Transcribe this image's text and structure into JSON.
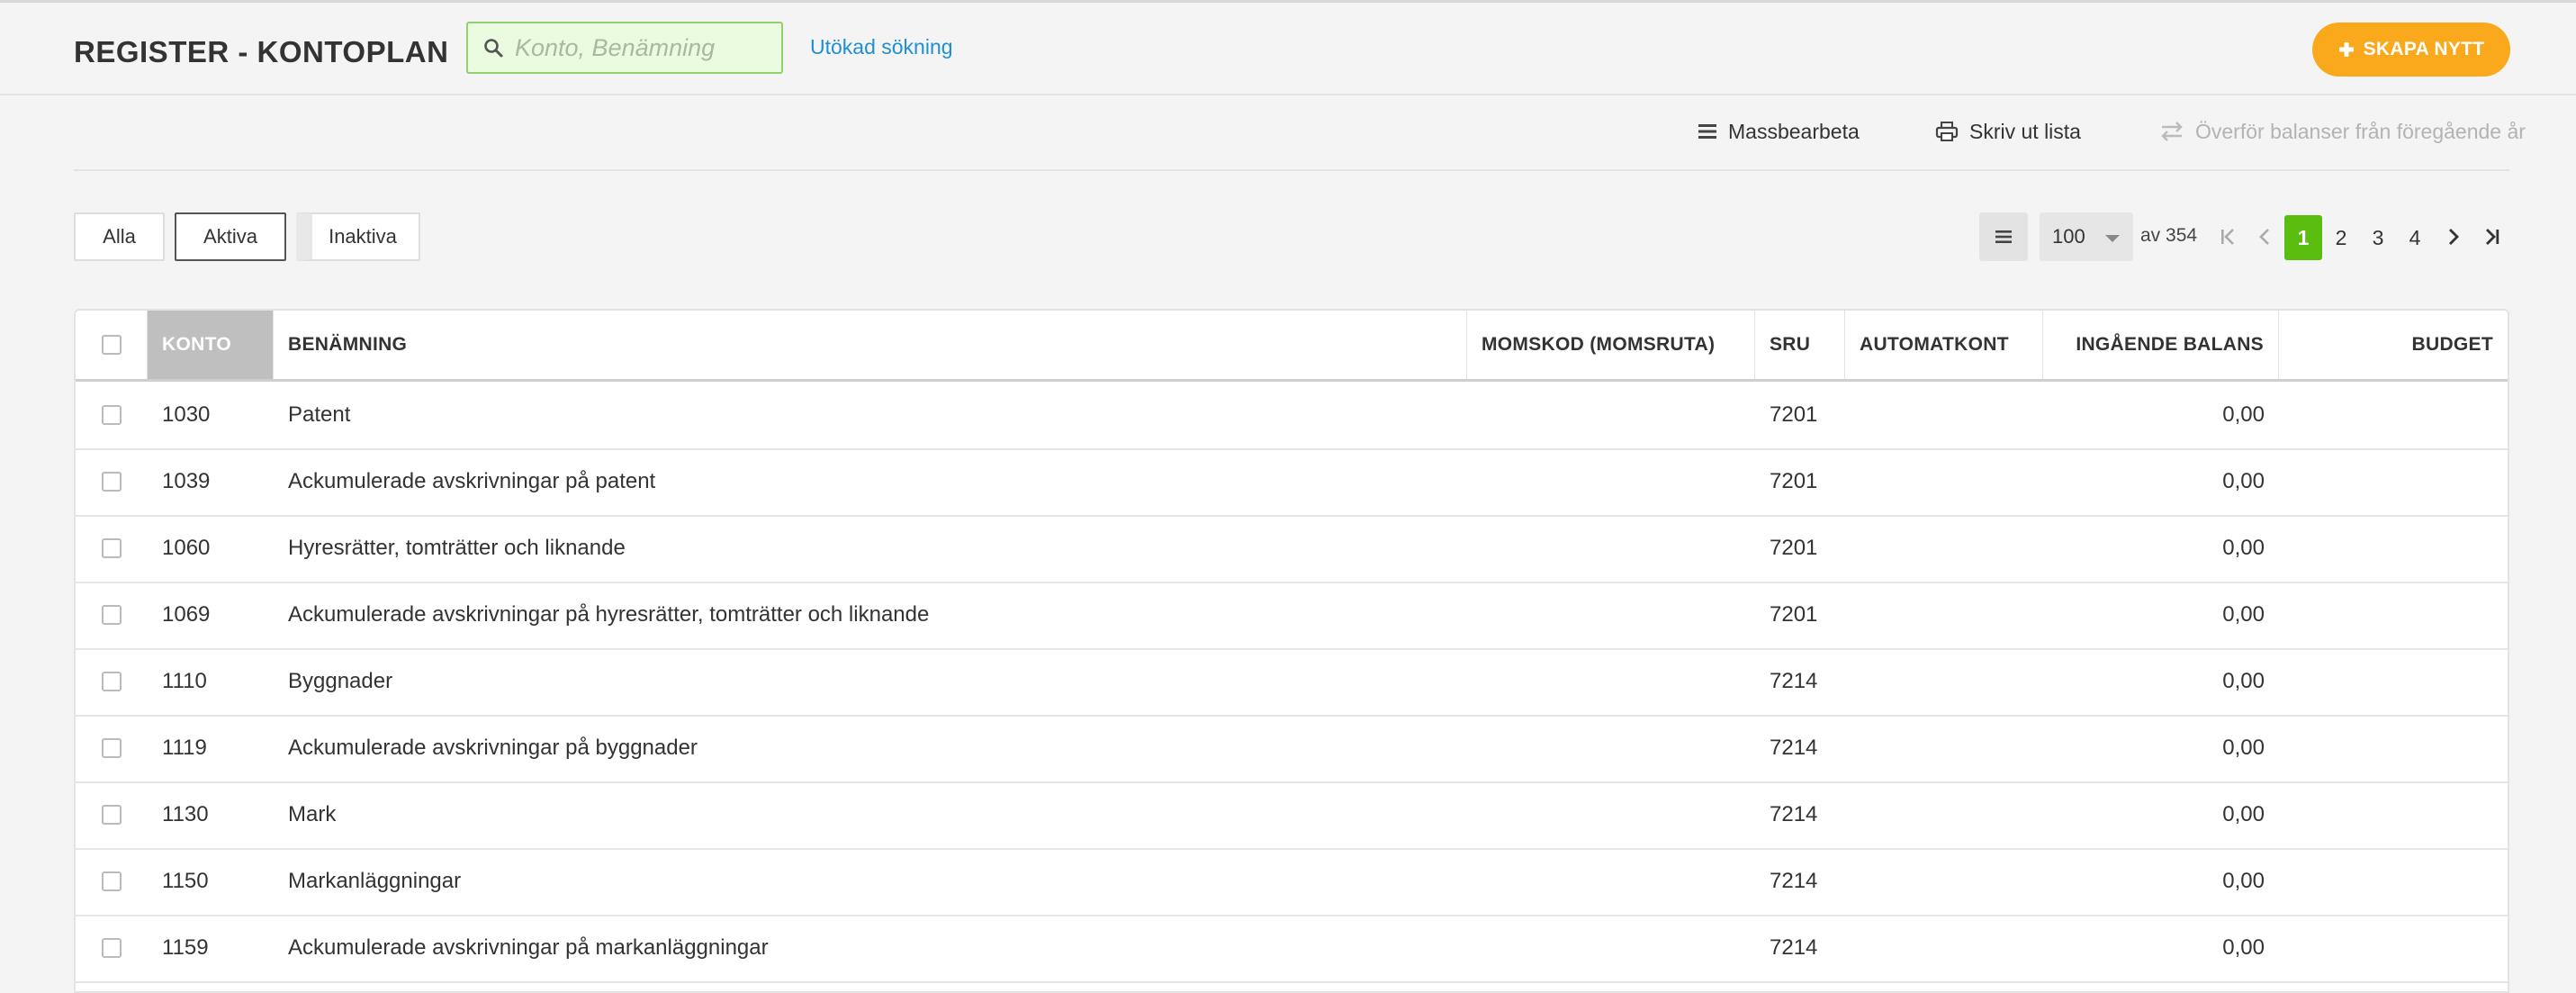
{
  "header": {
    "title": "REGISTER - KONTOPLAN",
    "search_placeholder": "Konto, Benämning",
    "advanced_search": "Utökad sökning",
    "create_label": "SKAPA NYTT"
  },
  "toolbar": {
    "mass_edit": "Massbearbeta",
    "print_list": "Skriv ut lista",
    "transfer_balances": "Överför balanser från föregående år"
  },
  "filters": {
    "all": "Alla",
    "active": "Aktiva",
    "inactive": "Inaktiva",
    "selected": "active"
  },
  "pagination": {
    "page_size": "100",
    "of_total": "av 354",
    "pages": [
      "1",
      "2",
      "3",
      "4"
    ],
    "current_page": "1"
  },
  "table": {
    "columns": {
      "konto": "KONTO",
      "benamning": "BENÄMNING",
      "momskod": "MOMSKOD (MOMSRUTA)",
      "sru": "SRU",
      "automatkont": "AUTOMATKONT",
      "ingaende": "INGÅENDE BALANS",
      "budget": "BUDGET"
    },
    "rows": [
      {
        "konto": "1030",
        "benamning": "Patent",
        "momskod": "",
        "sru": "7201",
        "automatkont": "",
        "ingaende": "0,00",
        "budget": ""
      },
      {
        "konto": "1039",
        "benamning": "Ackumulerade avskrivningar på patent",
        "momskod": "",
        "sru": "7201",
        "automatkont": "",
        "ingaende": "0,00",
        "budget": ""
      },
      {
        "konto": "1060",
        "benamning": "Hyresrätter, tomträtter och liknande",
        "momskod": "",
        "sru": "7201",
        "automatkont": "",
        "ingaende": "0,00",
        "budget": ""
      },
      {
        "konto": "1069",
        "benamning": "Ackumulerade avskrivningar på hyresrätter, tomträtter och liknande",
        "momskod": "",
        "sru": "7201",
        "automatkont": "",
        "ingaende": "0,00",
        "budget": ""
      },
      {
        "konto": "1110",
        "benamning": "Byggnader",
        "momskod": "",
        "sru": "7214",
        "automatkont": "",
        "ingaende": "0,00",
        "budget": ""
      },
      {
        "konto": "1119",
        "benamning": "Ackumulerade avskrivningar på byggnader",
        "momskod": "",
        "sru": "7214",
        "automatkont": "",
        "ingaende": "0,00",
        "budget": ""
      },
      {
        "konto": "1130",
        "benamning": "Mark",
        "momskod": "",
        "sru": "7214",
        "automatkont": "",
        "ingaende": "0,00",
        "budget": ""
      },
      {
        "konto": "1150",
        "benamning": "Markanläggningar",
        "momskod": "",
        "sru": "7214",
        "automatkont": "",
        "ingaende": "0,00",
        "budget": ""
      },
      {
        "konto": "1159",
        "benamning": "Ackumulerade avskrivningar på markanläggningar",
        "momskod": "",
        "sru": "7214",
        "automatkont": "",
        "ingaende": "0,00",
        "budget": ""
      }
    ]
  },
  "colors": {
    "accent_orange": "#f9a91b",
    "link_blue": "#1f8fcf",
    "page_green": "#5abd0f",
    "search_bg": "#eafbdf"
  }
}
